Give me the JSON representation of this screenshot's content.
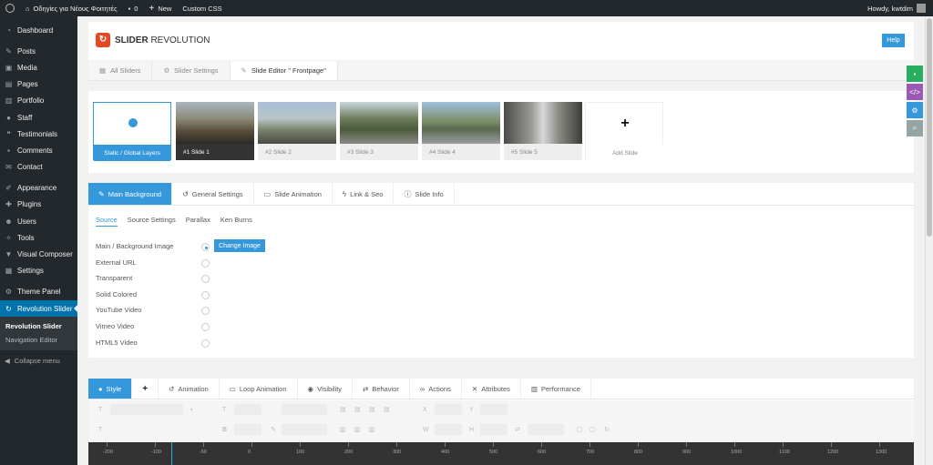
{
  "adminbar": {
    "site_name": "Οδηγίες για Νέους Φοιτητές",
    "comments_count": "0",
    "new_label": "New",
    "custom_css_label": "Custom CSS",
    "howdy": "Howdy, kwtdim"
  },
  "sidebar": {
    "items": [
      {
        "label": "Dashboard",
        "icon": "dashboard-icon"
      },
      {
        "label": "Posts",
        "icon": "pin-icon"
      },
      {
        "label": "Media",
        "icon": "media-icon"
      },
      {
        "label": "Pages",
        "icon": "pages-icon"
      },
      {
        "label": "Portfolio",
        "icon": "portfolio-icon"
      },
      {
        "label": "Staff",
        "icon": "staff-icon"
      },
      {
        "label": "Testimonials",
        "icon": "testimonials-icon"
      },
      {
        "label": "Comments",
        "icon": "comments-icon"
      },
      {
        "label": "Contact",
        "icon": "contact-icon"
      },
      {
        "label": "Appearance",
        "icon": "brush-icon"
      },
      {
        "label": "Plugins",
        "icon": "plugin-icon"
      },
      {
        "label": "Users",
        "icon": "users-icon"
      },
      {
        "label": "Tools",
        "icon": "tools-icon"
      },
      {
        "label": "Visual Composer",
        "icon": "vc-icon"
      },
      {
        "label": "Settings",
        "icon": "settings-icon"
      },
      {
        "label": "Theme Panel",
        "icon": "gear-icon"
      },
      {
        "label": "Revolution Slider",
        "icon": "refresh-icon"
      }
    ],
    "submenu": [
      "Revolution Slider",
      "Navigation Editor"
    ],
    "collapse": "Collapse menu"
  },
  "header": {
    "logo_bold": "SLIDER",
    "logo_rest": "REVOLUTION",
    "help": "Help"
  },
  "top_tabs": [
    "All Sliders",
    "Slider Settings",
    "Slide Editor \" Frontpage\""
  ],
  "slides": [
    {
      "label": "Static / Global Layers"
    },
    {
      "label": "#1 Slide 1"
    },
    {
      "label": "#2 Slide 2"
    },
    {
      "label": "#3 Slide 3"
    },
    {
      "label": "#4 Slide 4"
    },
    {
      "label": "#5 Slide 5"
    },
    {
      "label": "Add Slide"
    }
  ],
  "bg_tabs": [
    "Main Background",
    "General Settings",
    "Slide Animation",
    "Link & Seo",
    "Slide Info"
  ],
  "sub_tabs": [
    "Source",
    "Source Settings",
    "Parallax",
    "Ken Burns"
  ],
  "sources": [
    "Main / Background Image",
    "External URL",
    "Transparent",
    "Solid Colored",
    "YouTube Video",
    "Vimeo Video",
    "HTML5 Video"
  ],
  "change_image": "Change Image",
  "layer_tabs": [
    "Style",
    "+",
    "Animation",
    "Loop Animation",
    "Visibility",
    "Behavior",
    "Actions",
    "Attributes",
    "Performance"
  ],
  "toolbar": {
    "t_glyph": "T",
    "b_glyph": "B",
    "x_label": "X",
    "y_label": "Y",
    "w_label": "W",
    "h_label": "H"
  },
  "ruler": [
    "-200",
    "-100",
    "-50",
    "0",
    "100",
    "200",
    "300",
    "400",
    "500",
    "600",
    "700",
    "800",
    "900",
    "1000",
    "1100",
    "1200",
    "1300"
  ],
  "colors": {
    "accent": "#3498db",
    "admin_dark": "#23282d",
    "wp_blue": "#0073aa",
    "rs_orange": "#e34a24",
    "tool_green": "#27ae60",
    "tool_purple": "#9b59b6",
    "tool_blue": "#3498db",
    "tool_grey": "#95a5a6"
  }
}
